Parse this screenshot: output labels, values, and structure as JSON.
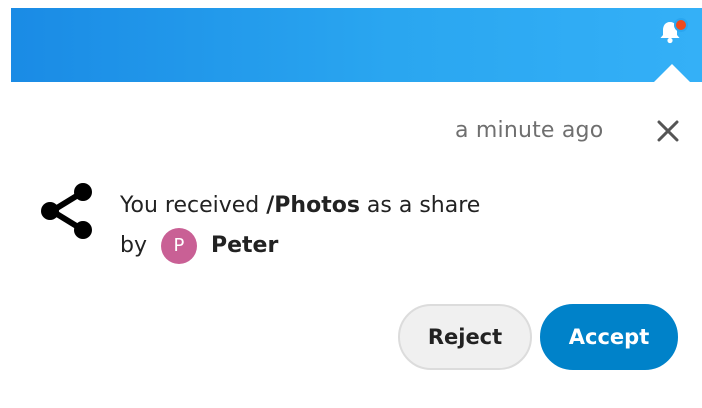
{
  "header": {
    "notification_icon": "bell-icon",
    "has_unread_dot": true
  },
  "notification": {
    "timestamp": "a minute ago",
    "close_icon": "close-icon",
    "type_icon": "share-icon",
    "message_prefix": "You received ",
    "item_name": "/Photos",
    "message_suffix": " as a share",
    "by_label": "by",
    "user_initial": "P",
    "user_name": "Peter",
    "avatar_color": "#c96095",
    "actions": {
      "reject_label": "Reject",
      "accept_label": "Accept"
    }
  },
  "colors": {
    "topbar": "#2aa6f0",
    "accent": "#0082c9",
    "unread_dot": "#ef4b1d"
  }
}
